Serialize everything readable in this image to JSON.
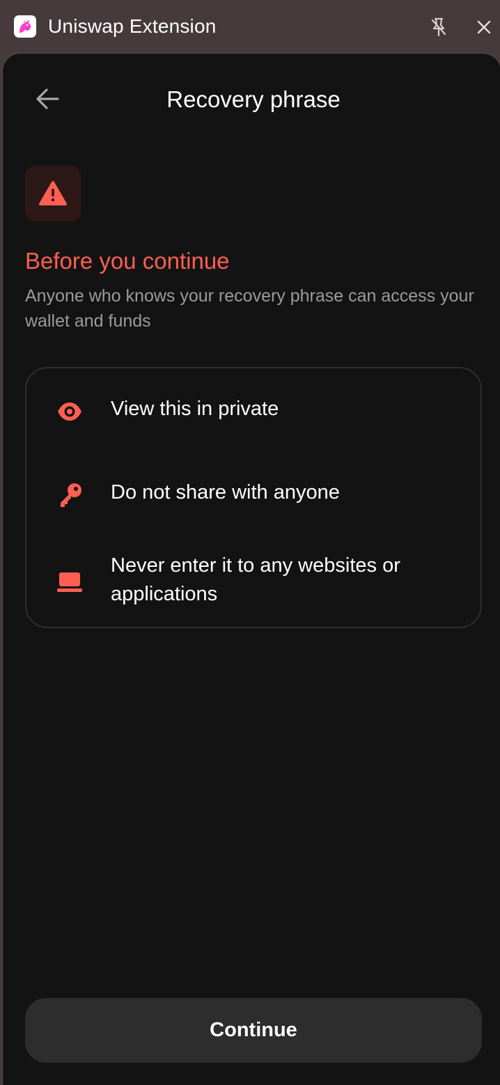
{
  "window": {
    "title": "Uniswap Extension",
    "app_icon": "uniswap-unicorn-logo",
    "pin_icon": "unpin-icon",
    "close_icon": "close-icon"
  },
  "header": {
    "back_icon": "arrow-left-icon",
    "title": "Recovery phrase"
  },
  "warning": {
    "icon": "warning-triangle-icon",
    "heading": "Before you continue",
    "description": "Anyone who knows your recovery phrase can access your wallet and funds"
  },
  "tips": [
    {
      "icon": "eye-icon",
      "label": "View this in private"
    },
    {
      "icon": "key-icon",
      "label": "Do not share with anyone"
    },
    {
      "icon": "laptop-icon",
      "label": "Never enter it to any websites or applications"
    }
  ],
  "footer": {
    "continue_label": "Continue"
  },
  "colors": {
    "accent": "#ff5f52",
    "panel_background": "#131313",
    "window_chrome": "#463a3d",
    "button_background": "#2d2d2d",
    "muted_text": "#9b9b9b",
    "brand_pink": "#fc72ff"
  }
}
